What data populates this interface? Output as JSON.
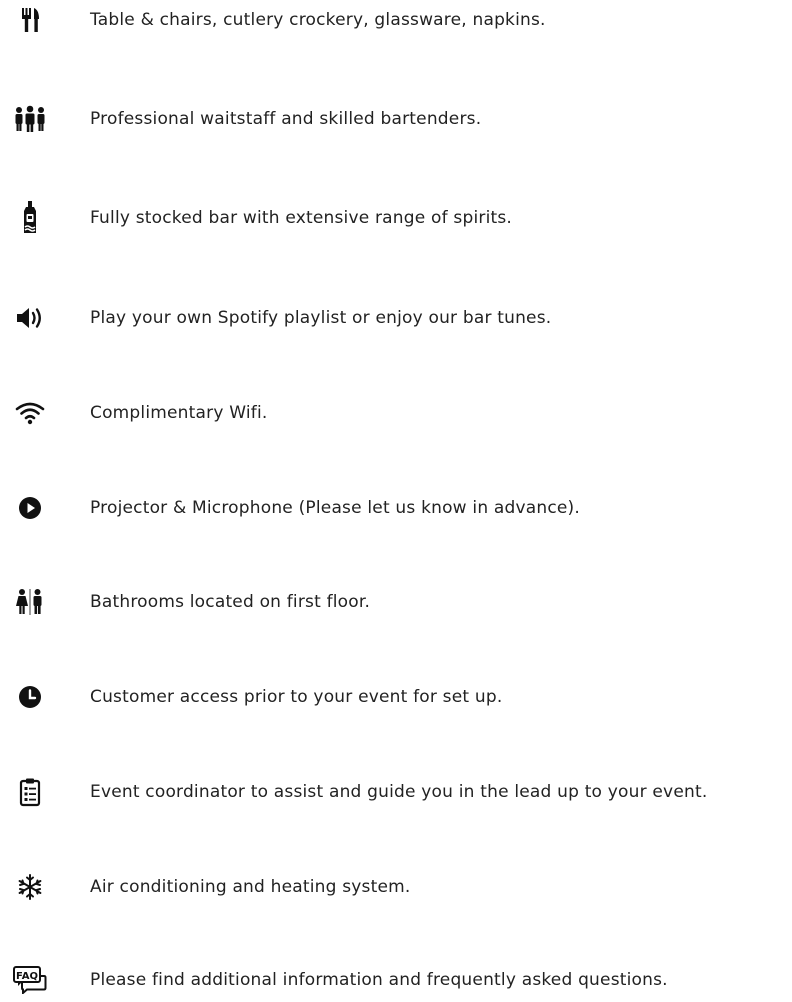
{
  "amenities": {
    "items": [
      {
        "icon": "cutlery-icon",
        "text": "Table & chairs, cutlery crockery, glassware, napkins."
      },
      {
        "icon": "staff-icon",
        "text": "Professional waitstaff and skilled bartenders."
      },
      {
        "icon": "bottle-icon",
        "text": "Fully stocked bar with extensive range of spirits."
      },
      {
        "icon": "speaker-icon",
        "text": "Play your own Spotify playlist or enjoy our bar tunes."
      },
      {
        "icon": "wifi-icon",
        "text": "Complimentary Wifi."
      },
      {
        "icon": "play-icon",
        "text": "Projector & Microphone (Please let us know in advance)."
      },
      {
        "icon": "restroom-icon",
        "text": "Bathrooms located on first floor."
      },
      {
        "icon": "clock-icon",
        "text": "Customer access prior to your event for set up."
      },
      {
        "icon": "clipboard-icon",
        "text": "Event coordinator to assist and guide you in the lead up to your event."
      },
      {
        "icon": "snowflake-icon",
        "text": "Air conditioning and heating system."
      },
      {
        "icon": "faq-icon",
        "text": "Please find additional information and frequently asked questions."
      }
    ]
  },
  "colors": {
    "text": "#222222",
    "icon": "#111111",
    "background": "#ffffff"
  }
}
